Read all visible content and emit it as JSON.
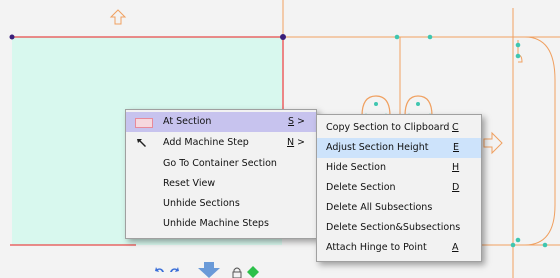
{
  "canvas": {
    "colors": {
      "background": "#f3f3f3",
      "selected_section_fill": "#d8f8ee",
      "border_red": "#e84a4a",
      "border_orange": "#f0a060",
      "node_purple": "#3a1f7a",
      "node_teal": "#3fc6b0"
    }
  },
  "context_menu": {
    "items": [
      {
        "label": "At Section",
        "shortcut": "S",
        "submenu": true,
        "icon": "section-icon"
      },
      {
        "label": "Add Machine Step",
        "shortcut": "N",
        "submenu": true,
        "icon": "cursor-arrow-icon"
      },
      {
        "label": "Go To Container Section",
        "shortcut": ""
      },
      {
        "label": "Reset View",
        "shortcut": ""
      },
      {
        "label": "Unhide Sections",
        "shortcut": ""
      },
      {
        "label": "Unhide Machine Steps",
        "shortcut": ""
      }
    ],
    "submenu_arrow": ">"
  },
  "submenu": {
    "items": [
      {
        "label": "Copy Section to Clipboard",
        "shortcut": "C"
      },
      {
        "label": "Adjust Section Height",
        "shortcut": "E"
      },
      {
        "label": "Hide Section",
        "shortcut": "H"
      },
      {
        "label": "Delete Section",
        "shortcut": "D"
      },
      {
        "label": "Delete All Subsections",
        "shortcut": ""
      },
      {
        "label": "Delete Section&Subsections",
        "shortcut": ""
      },
      {
        "label": "Attach Hinge to Point",
        "shortcut": "A"
      }
    ]
  },
  "toolbar": {
    "icons": [
      "undo-icon",
      "redo-icon",
      "down-arrow-icon",
      "lock-icon",
      "green-diamond-icon"
    ],
    "colors": {
      "undo": "#3a6ed8",
      "arrow": "#6a9ad8",
      "green": "#2cc04a"
    }
  }
}
